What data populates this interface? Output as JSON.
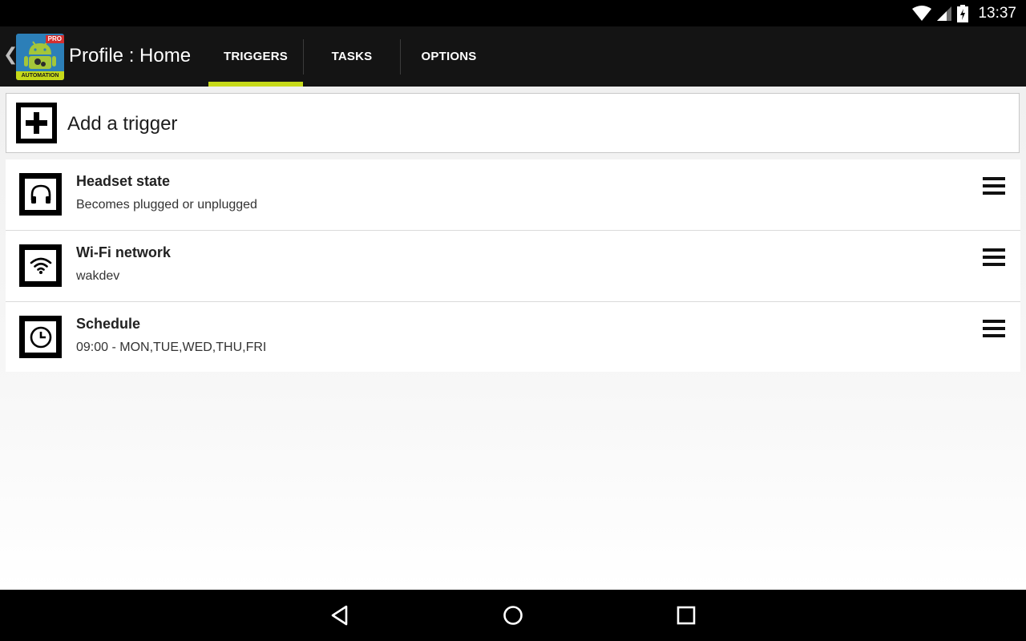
{
  "status_bar": {
    "time": "13:37"
  },
  "action_bar": {
    "app_icon_badge": "PRO",
    "app_icon_banner": "AUTOMATION",
    "title": "Profile : Home",
    "tabs": [
      {
        "label": "TRIGGERS",
        "active": true
      },
      {
        "label": "TASKS",
        "active": false
      },
      {
        "label": "OPTIONS",
        "active": false
      }
    ],
    "accent_color": "#c6d91a"
  },
  "add_trigger": {
    "label": "Add a trigger",
    "icon": "plus-box-icon"
  },
  "triggers": [
    {
      "title": "Headset state",
      "subtitle": "Becomes plugged or unplugged",
      "icon": "headphones-icon"
    },
    {
      "title": "Wi-Fi network",
      "subtitle": "wakdev",
      "icon": "wifi-icon"
    },
    {
      "title": "Schedule",
      "subtitle": "09:00 - MON,TUE,WED,THU,FRI",
      "icon": "clock-icon"
    }
  ],
  "nav_bar": {
    "buttons": [
      "back-icon",
      "home-icon",
      "recents-icon"
    ]
  }
}
